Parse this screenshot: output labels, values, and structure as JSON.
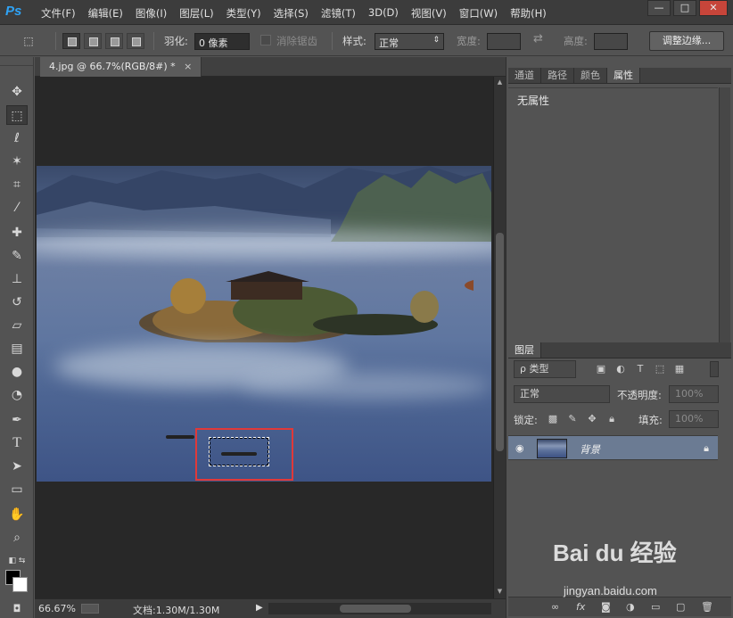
{
  "app": {
    "logo": "Ps"
  },
  "menu": [
    "文件(F)",
    "编辑(E)",
    "图像(I)",
    "图层(L)",
    "类型(Y)",
    "选择(S)",
    "滤镜(T)",
    "3D(D)",
    "视图(V)",
    "窗口(W)",
    "帮助(H)"
  ],
  "window": {
    "minimize": "—",
    "maximize": "□",
    "close": "✕"
  },
  "options": {
    "feather_label": "羽化:",
    "feather_value": "0 像素",
    "antialias_label": "消除锯齿",
    "style_label": "样式:",
    "style_value": "正常",
    "width_label": "宽度:",
    "height_label": "高度:",
    "refine_button": "调整边缘..."
  },
  "document": {
    "tab_title": "4.jpg @ 66.7%(RGB/8#) *",
    "tab_close": "×",
    "zoom": "66.67%",
    "doc_info": "文档:1.30M/1.30M"
  },
  "panels": {
    "top_tabs": [
      "通道",
      "路径",
      "颜色",
      "属性"
    ],
    "active_top_tab": "属性",
    "properties_text": "无属性",
    "layers_tab": "图层",
    "filter_type": "ρ 类型",
    "blend_mode": "正常",
    "opacity_label": "不透明度:",
    "opacity_value": "100%",
    "lock_label": "锁定:",
    "fill_label": "填充:",
    "fill_value": "100%",
    "layer_name": "背景"
  },
  "watermark": {
    "brand": "Bai du 经验",
    "url": "jingyan.baidu.com"
  },
  "colors": {
    "accent": "#2fa3f6",
    "highlight_box": "#e03939",
    "layer_selected": "#6b7b93"
  }
}
